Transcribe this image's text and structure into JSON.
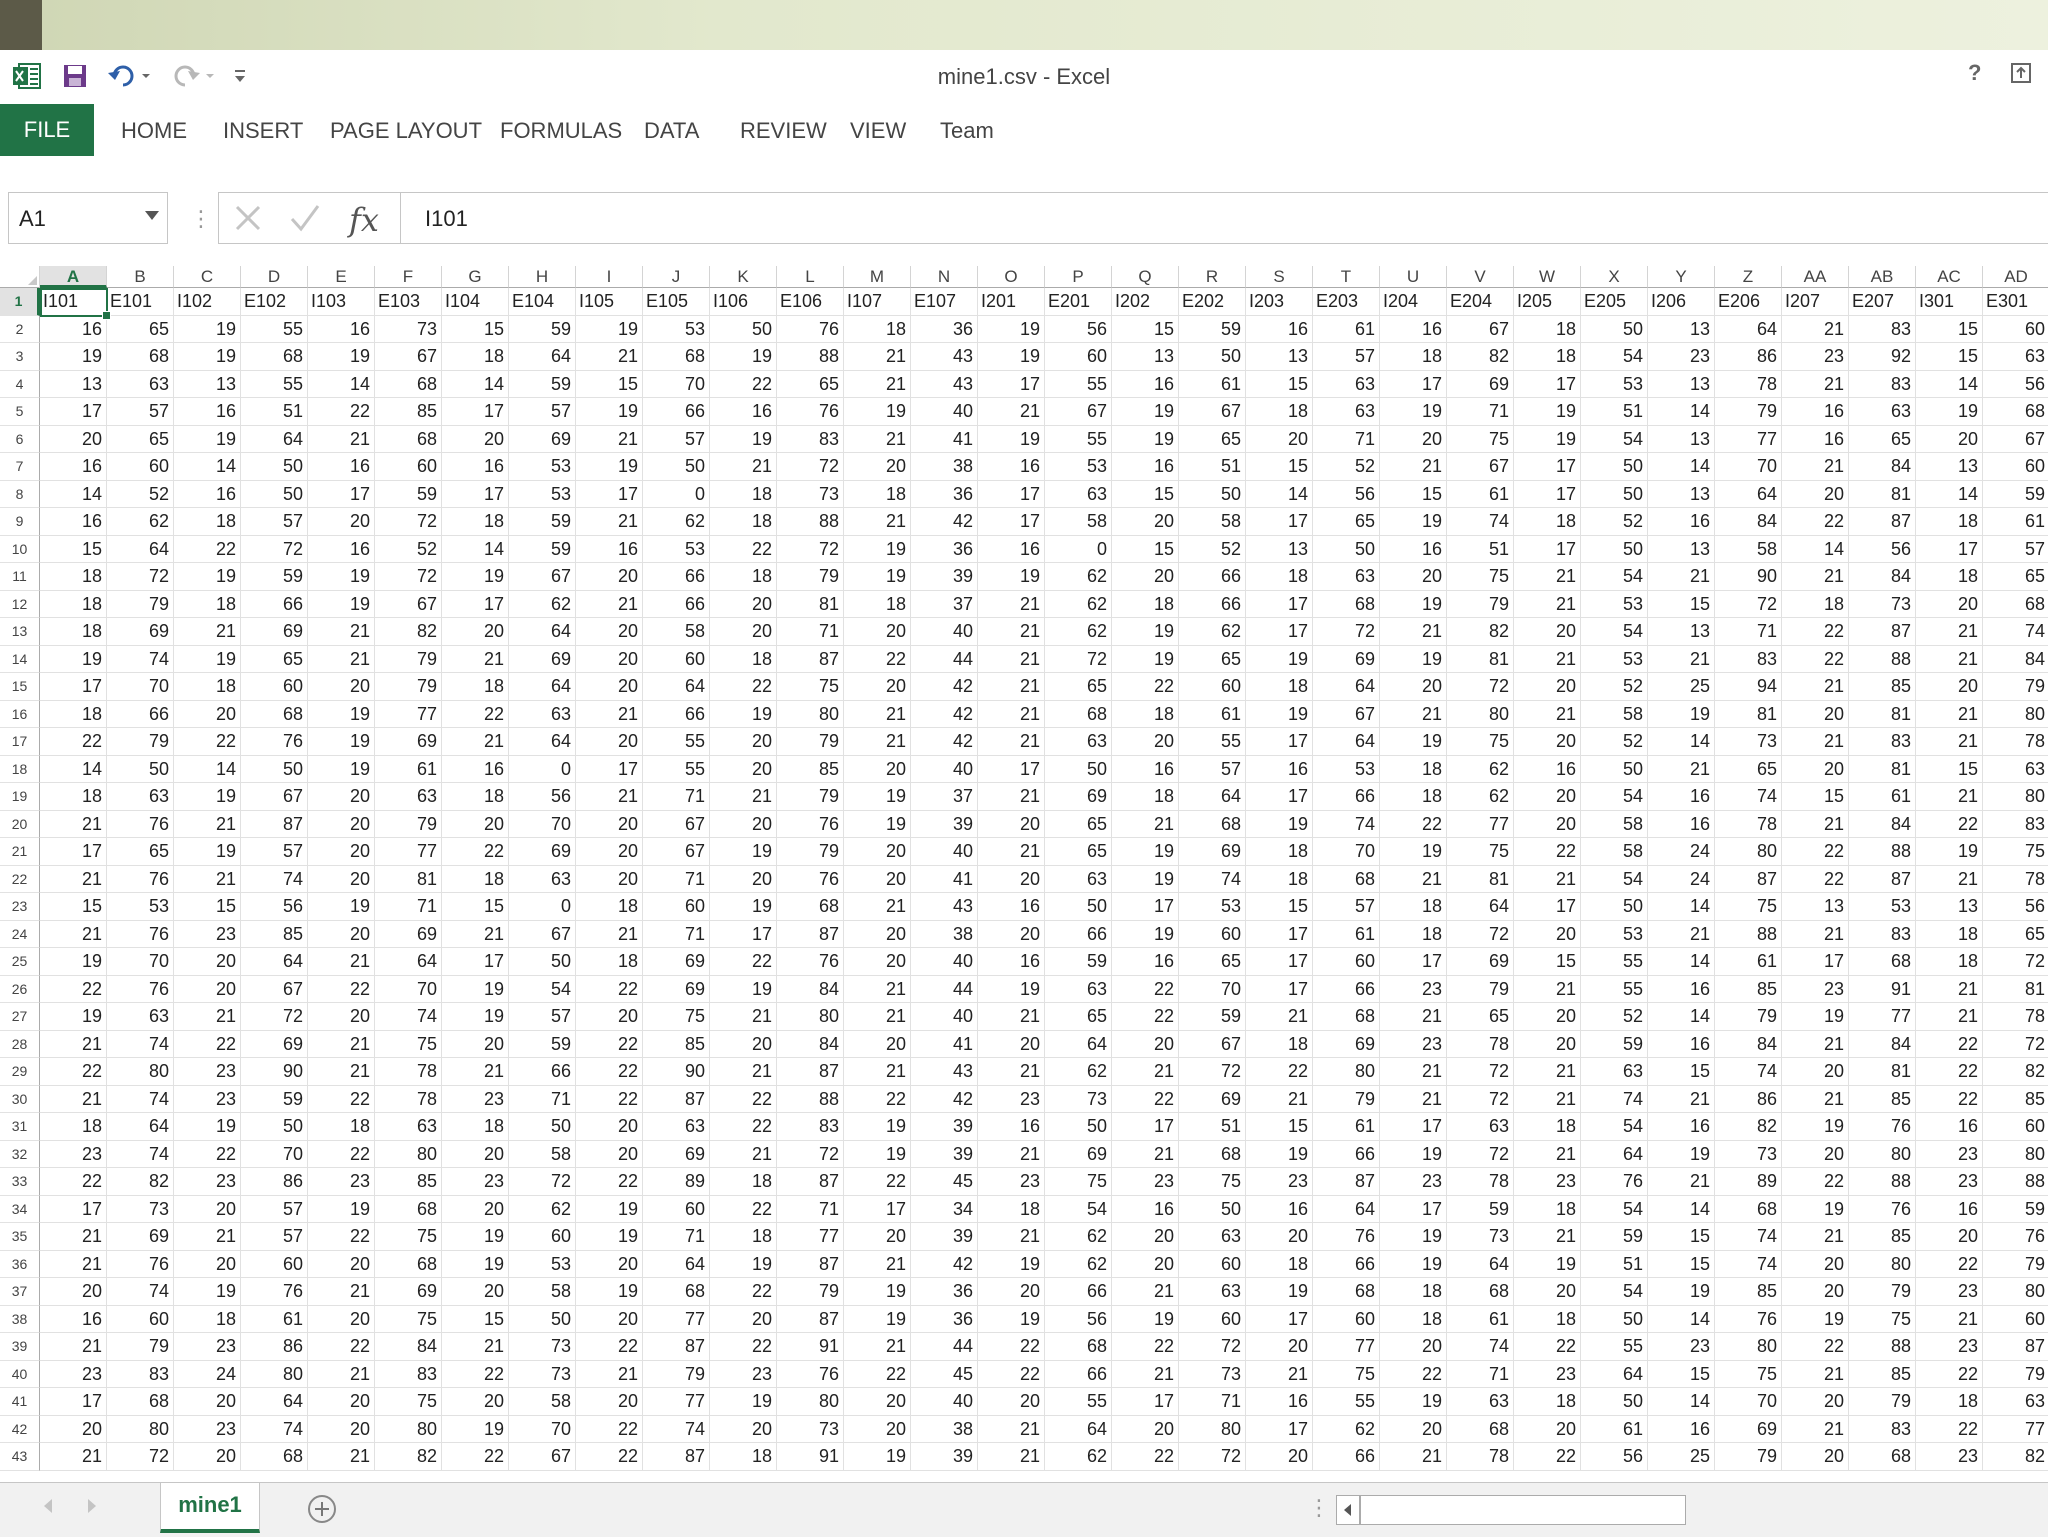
{
  "window": {
    "title": "mine1.csv - Excel"
  },
  "ribbon": {
    "file_tab": "FILE",
    "tabs": [
      "HOME",
      "INSERT",
      "PAGE LAYOUT",
      "FORMULAS",
      "DATA",
      "REVIEW",
      "VIEW",
      "Team"
    ]
  },
  "title_buttons": {
    "help": "?"
  },
  "icons": [
    "excel-logo-icon",
    "save-icon",
    "undo-icon",
    "redo-icon",
    "customize-qat-icon",
    "restore-ribbon-icon",
    "cancel-icon",
    "enter-icon",
    "fx-icon"
  ],
  "colors": {
    "accent": "#217346"
  },
  "formula_bar": {
    "name_box": "A1",
    "formula": "I101",
    "fx_label": "fx"
  },
  "sheet": {
    "columns": [
      "A",
      "B",
      "C",
      "D",
      "E",
      "F",
      "G",
      "H",
      "I",
      "J",
      "K",
      "L",
      "M",
      "N",
      "O",
      "P",
      "Q",
      "R",
      "S",
      "T",
      "U",
      "V",
      "W",
      "X",
      "Y",
      "Z",
      "AA",
      "AB",
      "AC",
      "AD"
    ],
    "row_numbers": [
      1,
      2,
      3,
      4,
      5,
      6,
      7,
      8,
      9,
      10,
      11,
      12,
      13,
      14,
      15,
      16,
      17,
      18,
      19,
      20,
      21,
      22,
      23,
      24,
      25,
      26,
      27,
      28,
      29,
      30,
      31,
      32,
      33,
      34,
      35,
      36,
      37,
      38,
      39,
      40,
      41,
      42,
      43
    ],
    "header_row": [
      "I101",
      "E101",
      "I102",
      "E102",
      "I103",
      "E103",
      "I104",
      "E104",
      "I105",
      "E105",
      "I106",
      "E106",
      "I107",
      "E107",
      "I201",
      "E201",
      "I202",
      "E202",
      "I203",
      "E203",
      "I204",
      "E204",
      "I205",
      "E205",
      "I206",
      "E206",
      "I207",
      "E207",
      "I301",
      "E301"
    ],
    "rows": [
      [
        16,
        65,
        19,
        55,
        16,
        73,
        15,
        59,
        19,
        53,
        50,
        76,
        18,
        36,
        19,
        56,
        15,
        59,
        16,
        61,
        16,
        67,
        18,
        50,
        13,
        64,
        21,
        83,
        15,
        60
      ],
      [
        19,
        68,
        19,
        68,
        19,
        67,
        18,
        64,
        21,
        68,
        19,
        88,
        21,
        43,
        19,
        60,
        13,
        50,
        13,
        57,
        18,
        82,
        18,
        54,
        23,
        86,
        23,
        92,
        15,
        63
      ],
      [
        13,
        63,
        13,
        55,
        14,
        68,
        14,
        59,
        15,
        70,
        22,
        65,
        21,
        43,
        17,
        55,
        16,
        61,
        15,
        63,
        17,
        69,
        17,
        53,
        13,
        78,
        21,
        83,
        14,
        56
      ],
      [
        17,
        57,
        16,
        51,
        22,
        85,
        17,
        57,
        19,
        66,
        16,
        76,
        19,
        40,
        21,
        67,
        19,
        67,
        18,
        63,
        19,
        71,
        19,
        51,
        14,
        79,
        16,
        63,
        19,
        68
      ],
      [
        20,
        65,
        19,
        64,
        21,
        68,
        20,
        69,
        21,
        57,
        19,
        83,
        21,
        41,
        19,
        55,
        19,
        65,
        20,
        71,
        20,
        75,
        19,
        54,
        13,
        77,
        16,
        65,
        20,
        67
      ],
      [
        16,
        60,
        14,
        50,
        16,
        60,
        16,
        53,
        19,
        50,
        21,
        72,
        20,
        38,
        16,
        53,
        16,
        51,
        15,
        52,
        21,
        67,
        17,
        50,
        14,
        70,
        21,
        84,
        13,
        60
      ],
      [
        14,
        52,
        16,
        50,
        17,
        59,
        17,
        53,
        17,
        0,
        18,
        73,
        18,
        36,
        17,
        63,
        15,
        50,
        14,
        56,
        15,
        61,
        17,
        50,
        13,
        64,
        20,
        81,
        14,
        59
      ],
      [
        16,
        62,
        18,
        57,
        20,
        72,
        18,
        59,
        21,
        62,
        18,
        88,
        21,
        42,
        17,
        58,
        20,
        58,
        17,
        65,
        19,
        74,
        18,
        52,
        16,
        84,
        22,
        87,
        18,
        61
      ],
      [
        15,
        64,
        22,
        72,
        16,
        52,
        14,
        59,
        16,
        53,
        22,
        72,
        19,
        36,
        16,
        0,
        15,
        52,
        13,
        50,
        16,
        51,
        17,
        50,
        13,
        58,
        14,
        56,
        17,
        57
      ],
      [
        18,
        72,
        19,
        59,
        19,
        72,
        19,
        67,
        20,
        66,
        18,
        79,
        19,
        39,
        19,
        62,
        20,
        66,
        18,
        63,
        20,
        75,
        21,
        54,
        21,
        90,
        21,
        84,
        18,
        65
      ],
      [
        18,
        79,
        18,
        66,
        19,
        67,
        17,
        62,
        21,
        66,
        20,
        81,
        18,
        37,
        21,
        62,
        18,
        66,
        17,
        68,
        19,
        79,
        21,
        53,
        15,
        72,
        18,
        73,
        20,
        68
      ],
      [
        18,
        69,
        21,
        69,
        21,
        82,
        20,
        64,
        20,
        58,
        20,
        71,
        20,
        40,
        21,
        62,
        19,
        62,
        17,
        72,
        21,
        82,
        20,
        54,
        13,
        71,
        22,
        87,
        21,
        74
      ],
      [
        19,
        74,
        19,
        65,
        21,
        79,
        21,
        69,
        20,
        60,
        18,
        87,
        22,
        44,
        21,
        72,
        19,
        65,
        19,
        69,
        19,
        81,
        21,
        53,
        21,
        83,
        22,
        88,
        21,
        84
      ],
      [
        17,
        70,
        18,
        60,
        20,
        79,
        18,
        64,
        20,
        64,
        22,
        75,
        20,
        42,
        21,
        65,
        22,
        60,
        18,
        64,
        20,
        72,
        20,
        52,
        25,
        94,
        21,
        85,
        20,
        79
      ],
      [
        18,
        66,
        20,
        68,
        19,
        77,
        22,
        63,
        21,
        66,
        19,
        80,
        21,
        42,
        21,
        68,
        18,
        61,
        19,
        67,
        21,
        80,
        21,
        58,
        19,
        81,
        20,
        81,
        21,
        80
      ],
      [
        22,
        79,
        22,
        76,
        19,
        69,
        21,
        64,
        20,
        55,
        20,
        79,
        21,
        42,
        21,
        63,
        20,
        55,
        17,
        64,
        19,
        75,
        20,
        52,
        14,
        73,
        21,
        83,
        21,
        78
      ],
      [
        14,
        50,
        14,
        50,
        19,
        61,
        16,
        0,
        17,
        55,
        20,
        85,
        20,
        40,
        17,
        50,
        16,
        57,
        16,
        53,
        18,
        62,
        16,
        50,
        21,
        65,
        20,
        81,
        15,
        63
      ],
      [
        18,
        63,
        19,
        67,
        20,
        63,
        18,
        56,
        21,
        71,
        21,
        79,
        19,
        37,
        21,
        69,
        18,
        64,
        17,
        66,
        18,
        62,
        20,
        54,
        16,
        74,
        15,
        61,
        21,
        80
      ],
      [
        21,
        76,
        21,
        87,
        20,
        79,
        20,
        70,
        20,
        67,
        20,
        76,
        19,
        39,
        20,
        65,
        21,
        68,
        19,
        74,
        22,
        77,
        20,
        58,
        16,
        78,
        21,
        84,
        22,
        83
      ],
      [
        17,
        65,
        19,
        57,
        20,
        77,
        22,
        69,
        20,
        67,
        19,
        79,
        20,
        40,
        21,
        65,
        19,
        69,
        18,
        70,
        19,
        75,
        22,
        58,
        24,
        80,
        22,
        88,
        19,
        75
      ],
      [
        21,
        76,
        21,
        74,
        20,
        81,
        18,
        63,
        20,
        71,
        20,
        76,
        20,
        41,
        20,
        63,
        19,
        74,
        18,
        68,
        21,
        81,
        21,
        54,
        24,
        87,
        22,
        87,
        21,
        78
      ],
      [
        15,
        53,
        15,
        56,
        19,
        71,
        15,
        0,
        18,
        60,
        19,
        68,
        21,
        43,
        16,
        50,
        17,
        53,
        15,
        57,
        18,
        64,
        17,
        50,
        14,
        75,
        13,
        53,
        13,
        56
      ],
      [
        21,
        76,
        23,
        85,
        20,
        69,
        21,
        67,
        21,
        71,
        17,
        87,
        20,
        38,
        20,
        66,
        19,
        60,
        17,
        61,
        18,
        72,
        20,
        53,
        21,
        88,
        21,
        83,
        18,
        65
      ],
      [
        19,
        70,
        20,
        64,
        21,
        64,
        17,
        50,
        18,
        69,
        22,
        76,
        20,
        40,
        16,
        59,
        16,
        65,
        17,
        60,
        17,
        69,
        15,
        55,
        14,
        61,
        17,
        68,
        18,
        72
      ],
      [
        22,
        76,
        20,
        67,
        22,
        70,
        19,
        54,
        22,
        69,
        19,
        84,
        21,
        44,
        19,
        63,
        22,
        70,
        17,
        66,
        23,
        79,
        21,
        55,
        16,
        85,
        23,
        91,
        21,
        81
      ],
      [
        19,
        63,
        21,
        72,
        20,
        74,
        19,
        57,
        20,
        75,
        21,
        80,
        21,
        40,
        21,
        65,
        22,
        59,
        21,
        68,
        21,
        65,
        20,
        52,
        14,
        79,
        19,
        77,
        21,
        78
      ],
      [
        21,
        74,
        22,
        69,
        21,
        75,
        20,
        59,
        22,
        85,
        20,
        84,
        20,
        41,
        20,
        64,
        20,
        67,
        18,
        69,
        23,
        78,
        20,
        59,
        16,
        84,
        21,
        84,
        22,
        72
      ],
      [
        22,
        80,
        23,
        90,
        21,
        78,
        21,
        66,
        22,
        90,
        21,
        87,
        21,
        43,
        21,
        62,
        21,
        72,
        22,
        80,
        21,
        72,
        21,
        63,
        15,
        74,
        20,
        81,
        22,
        82
      ],
      [
        21,
        74,
        23,
        59,
        22,
        78,
        23,
        71,
        22,
        87,
        22,
        88,
        22,
        42,
        23,
        73,
        22,
        69,
        21,
        79,
        21,
        72,
        21,
        74,
        21,
        86,
        21,
        85,
        22,
        85
      ],
      [
        18,
        64,
        19,
        50,
        18,
        63,
        18,
        50,
        20,
        63,
        22,
        83,
        19,
        39,
        16,
        50,
        17,
        51,
        15,
        61,
        17,
        63,
        18,
        54,
        16,
        82,
        19,
        76,
        16,
        60
      ],
      [
        23,
        74,
        22,
        70,
        22,
        80,
        20,
        58,
        20,
        69,
        21,
        72,
        19,
        39,
        21,
        69,
        21,
        68,
        19,
        66,
        19,
        72,
        21,
        64,
        19,
        73,
        20,
        80,
        23,
        80
      ],
      [
        22,
        82,
        23,
        86,
        23,
        85,
        23,
        72,
        22,
        89,
        18,
        87,
        22,
        45,
        23,
        75,
        23,
        75,
        23,
        87,
        23,
        78,
        23,
        76,
        21,
        89,
        22,
        88,
        23,
        88
      ],
      [
        17,
        73,
        20,
        57,
        19,
        68,
        20,
        62,
        19,
        60,
        22,
        71,
        17,
        34,
        18,
        54,
        16,
        50,
        16,
        64,
        17,
        59,
        18,
        54,
        14,
        68,
        19,
        76,
        16,
        59
      ],
      [
        21,
        69,
        21,
        57,
        22,
        75,
        19,
        60,
        19,
        71,
        18,
        77,
        20,
        39,
        21,
        62,
        20,
        63,
        20,
        76,
        19,
        73,
        21,
        59,
        15,
        74,
        21,
        85,
        20,
        76
      ],
      [
        21,
        76,
        20,
        60,
        20,
        68,
        19,
        53,
        20,
        64,
        19,
        87,
        21,
        42,
        19,
        62,
        20,
        60,
        18,
        66,
        19,
        64,
        19,
        51,
        15,
        74,
        20,
        80,
        22,
        79
      ],
      [
        20,
        74,
        19,
        76,
        21,
        69,
        20,
        58,
        19,
        68,
        22,
        79,
        19,
        36,
        20,
        66,
        21,
        63,
        19,
        68,
        18,
        68,
        20,
        54,
        19,
        85,
        20,
        79,
        23,
        80
      ],
      [
        16,
        60,
        18,
        61,
        20,
        75,
        15,
        50,
        20,
        77,
        20,
        87,
        19,
        36,
        19,
        56,
        19,
        60,
        17,
        60,
        18,
        61,
        18,
        50,
        14,
        76,
        19,
        75,
        21,
        60
      ],
      [
        21,
        79,
        23,
        86,
        22,
        84,
        21,
        73,
        22,
        87,
        22,
        91,
        21,
        44,
        22,
        68,
        22,
        72,
        20,
        77,
        20,
        74,
        22,
        55,
        23,
        80,
        22,
        88,
        23,
        87
      ],
      [
        23,
        83,
        24,
        80,
        21,
        83,
        22,
        73,
        21,
        79,
        23,
        76,
        22,
        45,
        22,
        66,
        21,
        73,
        21,
        75,
        22,
        71,
        23,
        64,
        15,
        75,
        21,
        85,
        22,
        79
      ],
      [
        17,
        68,
        20,
        64,
        20,
        75,
        20,
        58,
        20,
        77,
        19,
        80,
        20,
        40,
        20,
        55,
        17,
        71,
        16,
        55,
        19,
        63,
        18,
        50,
        14,
        70,
        20,
        79,
        18,
        63
      ],
      [
        20,
        80,
        23,
        74,
        20,
        80,
        19,
        70,
        22,
        74,
        20,
        73,
        20,
        38,
        21,
        64,
        20,
        80,
        17,
        62,
        20,
        68,
        20,
        61,
        16,
        69,
        21,
        83,
        22,
        77
      ],
      [
        21,
        72,
        20,
        68,
        21,
        82,
        22,
        67,
        22,
        87,
        18,
        91,
        19,
        39,
        21,
        62,
        22,
        72,
        20,
        66,
        21,
        78,
        22,
        56,
        25,
        79,
        20,
        68,
        23,
        82
      ]
    ],
    "tabs": [
      "mine1"
    ]
  }
}
